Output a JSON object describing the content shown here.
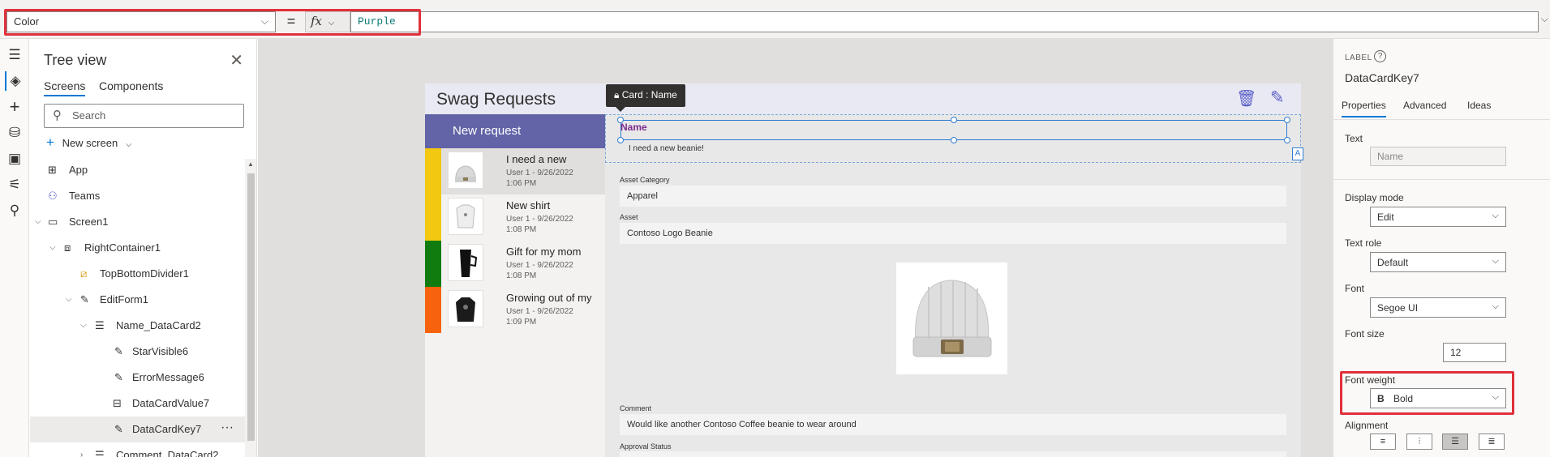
{
  "formula_bar": {
    "property": "Color",
    "equals": "=",
    "fx": "fx",
    "formula": "Purple"
  },
  "left_rail": {
    "icons": [
      "menu-icon",
      "layers-icon",
      "insert-icon",
      "data-icon",
      "media-icon",
      "advanced-tools-icon",
      "search-icon"
    ]
  },
  "tree": {
    "title": "Tree view",
    "tabs": [
      "Screens",
      "Components"
    ],
    "search_placeholder": "Search",
    "new_screen": "New screen",
    "items": [
      {
        "label": "App"
      },
      {
        "label": "Teams"
      },
      {
        "label": "Screen1"
      },
      {
        "label": "RightContainer1"
      },
      {
        "label": "TopBottomDivider1"
      },
      {
        "label": "EditForm1"
      },
      {
        "label": "Name_DataCard2"
      },
      {
        "label": "StarVisible6"
      },
      {
        "label": "ErrorMessage6"
      },
      {
        "label": "DataCardValue7"
      },
      {
        "label": "DataCardKey7"
      },
      {
        "label": "Comment_DataCard2"
      }
    ],
    "more": "···"
  },
  "app": {
    "title": "Swag Requests",
    "new_request": "New request",
    "requests": [
      {
        "title": "I need a new",
        "user": "User 1 - 9/26/2022",
        "time": "1:06 PM",
        "color": "#f2c811"
      },
      {
        "title": "New shirt",
        "user": "User 1 - 9/26/2022",
        "time": "1:08 PM",
        "color": "#f2c811"
      },
      {
        "title": "Gift for my mom",
        "user": "User 1 - 9/26/2022",
        "time": "1:08 PM",
        "color": "#107c10"
      },
      {
        "title": "Growing out of my",
        "user": "User 1 - 9/26/2022",
        "time": "1:09 PM",
        "color": "#f7630c"
      }
    ],
    "card_tooltip": "Card : Name",
    "form": {
      "name_label": "Name",
      "name_value": "I need a new beanie!",
      "asset_category_label": "Asset Category",
      "asset_category_value": "Apparel",
      "asset_label": "Asset",
      "asset_value": "Contoso Logo Beanie",
      "comment_label": "Comment",
      "comment_value": "Would like another Contoso Coffee beanie to wear around",
      "approval_label": "Approval Status",
      "badge": "A"
    }
  },
  "right_pane": {
    "type": "LABEL",
    "help": "?",
    "name": "DataCardKey7",
    "tabs": [
      "Properties",
      "Advanced",
      "Ideas"
    ],
    "text_label": "Text",
    "text_value": "Name",
    "display_mode_label": "Display mode",
    "display_mode_value": "Edit",
    "text_role_label": "Text role",
    "text_role_value": "Default",
    "font_label": "Font",
    "font_value": "Segoe UI",
    "font_size_label": "Font size",
    "font_size_value": "12",
    "font_weight_label": "Font weight",
    "font_weight_value": "Bold",
    "font_weight_icon": "B",
    "alignment_label": "Alignment"
  }
}
